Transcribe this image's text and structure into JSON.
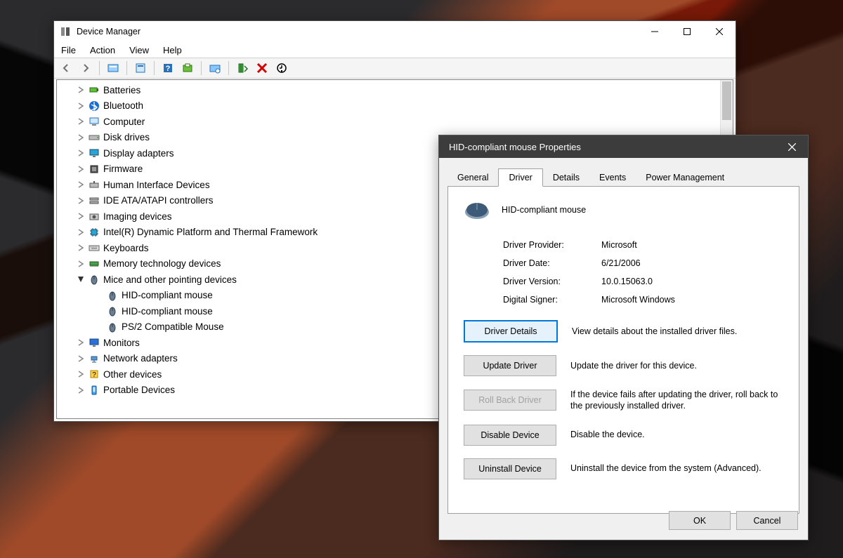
{
  "device_manager": {
    "title": "Device Manager",
    "menus": [
      "File",
      "Action",
      "View",
      "Help"
    ],
    "toolbar_icons": [
      "back",
      "forward",
      "show-hidden",
      "properties",
      "help",
      "update",
      "scan",
      "add-legacy",
      "remove",
      "details"
    ],
    "tree": [
      {
        "label": "Batteries",
        "chevron": ">",
        "icon": "battery"
      },
      {
        "label": "Bluetooth",
        "chevron": ">",
        "icon": "bluetooth"
      },
      {
        "label": "Computer",
        "chevron": ">",
        "icon": "computer"
      },
      {
        "label": "Disk drives",
        "chevron": ">",
        "icon": "disk"
      },
      {
        "label": "Display adapters",
        "chevron": ">",
        "icon": "display"
      },
      {
        "label": "Firmware",
        "chevron": ">",
        "icon": "firmware"
      },
      {
        "label": "Human Interface Devices",
        "chevron": ">",
        "icon": "hid"
      },
      {
        "label": "IDE ATA/ATAPI controllers",
        "chevron": ">",
        "icon": "ide"
      },
      {
        "label": "Imaging devices",
        "chevron": ">",
        "icon": "imaging"
      },
      {
        "label": "Intel(R) Dynamic Platform and Thermal Framework",
        "chevron": ">",
        "icon": "chip"
      },
      {
        "label": "Keyboards",
        "chevron": ">",
        "icon": "keyboard"
      },
      {
        "label": "Memory technology devices",
        "chevron": ">",
        "icon": "memory"
      },
      {
        "label": "Mice and other pointing devices",
        "chevron": "v",
        "icon": "mouse",
        "children": [
          {
            "label": "HID-compliant mouse",
            "icon": "mouse"
          },
          {
            "label": "HID-compliant mouse",
            "icon": "mouse"
          },
          {
            "label": "PS/2 Compatible Mouse",
            "icon": "mouse"
          }
        ]
      },
      {
        "label": "Monitors",
        "chevron": ">",
        "icon": "monitor"
      },
      {
        "label": "Network adapters",
        "chevron": ">",
        "icon": "network"
      },
      {
        "label": "Other devices",
        "chevron": ">",
        "icon": "other"
      },
      {
        "label": "Portable Devices",
        "chevron": ">",
        "icon": "portable"
      }
    ]
  },
  "properties": {
    "title": "HID-compliant mouse Properties",
    "tabs": [
      "General",
      "Driver",
      "Details",
      "Events",
      "Power Management"
    ],
    "active_tab": "Driver",
    "device_name": "HID-compliant mouse",
    "info": {
      "provider_label": "Driver Provider:",
      "provider": "Microsoft",
      "date_label": "Driver Date:",
      "date": "6/21/2006",
      "version_label": "Driver Version:",
      "version": "10.0.15063.0",
      "signer_label": "Digital Signer:",
      "signer": "Microsoft Windows"
    },
    "actions": {
      "details_btn": "Driver Details",
      "details_desc": "View details about the installed driver files.",
      "update_btn": "Update Driver",
      "update_desc": "Update the driver for this device.",
      "rollback_btn": "Roll Back Driver",
      "rollback_desc": "If the device fails after updating the driver, roll back to the previously installed driver.",
      "disable_btn": "Disable Device",
      "disable_desc": "Disable the device.",
      "uninstall_btn": "Uninstall Device",
      "uninstall_desc": "Uninstall the device from the system (Advanced)."
    },
    "ok": "OK",
    "cancel": "Cancel"
  }
}
